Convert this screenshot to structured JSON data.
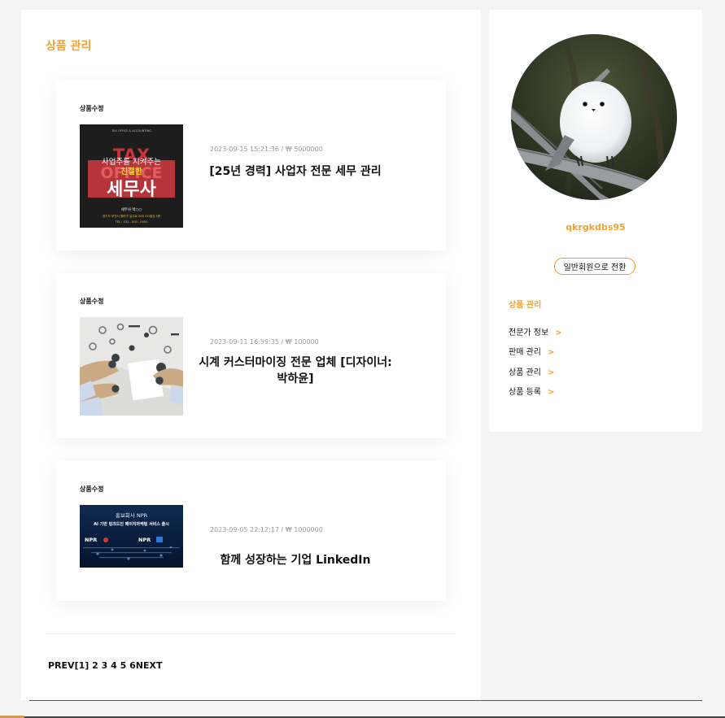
{
  "page": {
    "title": "상품 관리"
  },
  "products": [
    {
      "edit_label": "상품수정",
      "meta": "2023-09-15 15:21:36 / ₩ 5000000",
      "title": "[25년 경력] 사업자 전문 세무 관리",
      "thumb": {
        "small_header": "TAX OFFICE & ACCOUNTING",
        "bg_word1": "TAX",
        "bg_word2": "OFFICE",
        "line1": "사업주를 지켜주는",
        "line2": "친절한",
        "line3": "세무사",
        "line4": "세무사 박○○",
        "addr": "경기도 부천시 원미구 길주로 000 OO빌딩 5층",
        "tel": "TEL : 032 - 000 - 0000"
      }
    },
    {
      "edit_label": "상품수정",
      "meta": "2023-09-11 16:59:35 / ₩ 100000",
      "title": "시계 커스터마이징 전문 업체 [디자이너:박하윤]"
    },
    {
      "edit_label": "상품수정",
      "meta": "2023-09-05 22:12:17 / ₩ 1000000",
      "title": "함께 성장하는 기업 LinkedIn",
      "thumb": {
        "line1": "홍보회사 NPR",
        "line2": "AI 기반 링크드인 페이지마케팅 서비스 출시",
        "logo1": "NPR",
        "logo2": "NPR"
      }
    }
  ],
  "pagination": {
    "prev": "PREV",
    "current": "[1]",
    "pages": [
      "2",
      "3",
      "4",
      "5",
      "6"
    ],
    "next": "NEXT"
  },
  "sidebar": {
    "username": "qkrgkdbs95",
    "switch_button": "일반회원으로 전환",
    "heading": "상품 관리",
    "links": [
      "전문가 정보",
      "판매 관리",
      "상품 관리",
      "상품 등록"
    ],
    "chevron": ">"
  },
  "colors": {
    "accent": "#f0a233",
    "button_border": "#e89a2a"
  }
}
